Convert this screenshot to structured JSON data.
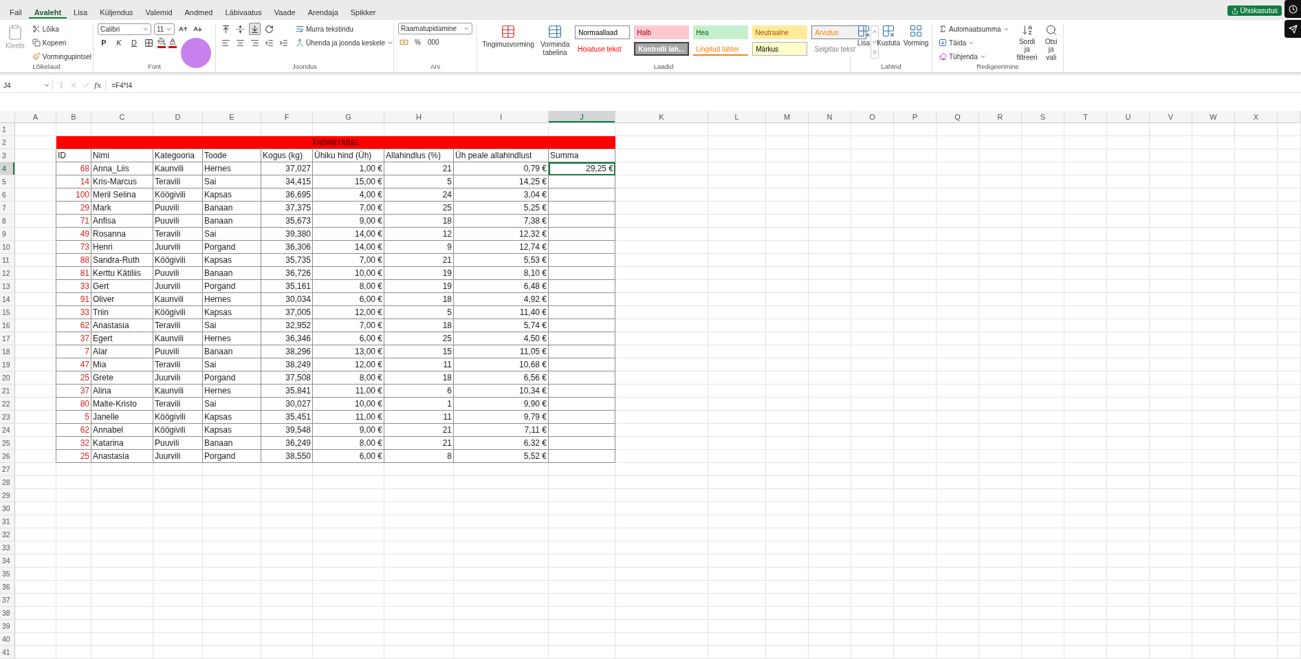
{
  "menu_tabs": [
    {
      "label": "Fail",
      "selected": false
    },
    {
      "label": "Avaleht",
      "selected": true
    },
    {
      "label": "Lisa",
      "selected": false
    },
    {
      "label": "Küljendus",
      "selected": false
    },
    {
      "label": "Valemid",
      "selected": false
    },
    {
      "label": "Andmed",
      "selected": false
    },
    {
      "label": "Läbivaatus",
      "selected": false
    },
    {
      "label": "Vaade",
      "selected": false
    },
    {
      "label": "Arendaja",
      "selected": false
    },
    {
      "label": "Spikker",
      "selected": false
    }
  ],
  "share_button": "Ühiskasutus",
  "ribbon": {
    "clipboard": {
      "paste": {
        "label": "Kleebi",
        "disabled": true
      },
      "items": [
        "Lõika",
        "Kopeeri",
        "Vormingupintsel"
      ],
      "label": "Lõikelaud"
    },
    "font": {
      "font_name": "Calibri",
      "font_size": "11",
      "style_buttons": [
        "P",
        "K",
        "D"
      ],
      "label": "Font"
    },
    "alignment": {
      "wrap_text": "Murra tekstiridu",
      "merge": "Ühenda ja joonda keskele",
      "label": "Joondus"
    },
    "number": {
      "format": "Raamatupidamine",
      "buttons": [
        "%",
        "000"
      ],
      "label": "Arv"
    },
    "styles": {
      "conditional": "Tingimusvorming",
      "format_table": "Vorminda tabelina",
      "gallery": [
        {
          "label": "Normaallaad",
          "kind": "normal"
        },
        {
          "label": "Halb",
          "kind": "bad"
        },
        {
          "label": "Hea",
          "kind": "good"
        },
        {
          "label": "Neutraalne",
          "kind": "neutral"
        },
        {
          "label": "Arvutus",
          "kind": "calculation"
        },
        {
          "label": "Hoiatuse tekst",
          "kind": "warning"
        },
        {
          "label": "Kontrolli lah...",
          "kind": "check"
        },
        {
          "label": "Lingitud lahter",
          "kind": "linked"
        },
        {
          "label": "Märkus",
          "kind": "note"
        },
        {
          "label": "Selgitav tekst",
          "kind": "explanatory"
        }
      ],
      "label": "Laadid"
    },
    "cells": {
      "buttons": [
        "Lisa",
        "Kustuta",
        "Vorming"
      ],
      "label": "Lahtrid"
    },
    "editing": {
      "autosum": "Automaatsumma",
      "fill": "Täida",
      "clear": "Tühjenda",
      "sort": "Sordi ja filtreeri",
      "find": "Otsi ja vali",
      "label": "Redigeerimine"
    }
  },
  "cursor_highlight": true,
  "name_box": "J4",
  "function_label": "fx",
  "formula": "=F4*I4",
  "sheet": {
    "column_headers": [
      {
        "label": "A",
        "selected": false
      },
      {
        "label": "B",
        "selected": false
      },
      {
        "label": "C",
        "selected": false
      },
      {
        "label": "D",
        "selected": false
      },
      {
        "label": "E",
        "selected": false
      },
      {
        "label": "F",
        "selected": false
      },
      {
        "label": "G",
        "selected": false
      },
      {
        "label": "H",
        "selected": false
      },
      {
        "label": "I",
        "selected": false
      },
      {
        "label": "J",
        "selected": true
      },
      {
        "label": "K",
        "selected": false
      },
      {
        "label": "L",
        "selected": false
      },
      {
        "label": "M",
        "selected": false
      },
      {
        "label": "N",
        "selected": false
      },
      {
        "label": "O",
        "selected": false
      },
      {
        "label": "P",
        "selected": false
      },
      {
        "label": "Q",
        "selected": false
      },
      {
        "label": "R",
        "selected": false
      },
      {
        "label": "S",
        "selected": false
      },
      {
        "label": "T",
        "selected": false
      },
      {
        "label": "U",
        "selected": false
      },
      {
        "label": "V",
        "selected": false
      },
      {
        "label": "W",
        "selected": false
      },
      {
        "label": "X",
        "selected": false
      }
    ],
    "row_numbers": [
      {
        "label": "1",
        "selected": false
      },
      {
        "label": "2",
        "selected": false
      },
      {
        "label": "3",
        "selected": false
      },
      {
        "label": "4",
        "selected": true
      },
      {
        "label": "5",
        "selected": false
      },
      {
        "label": "6",
        "selected": false
      },
      {
        "label": "7",
        "selected": false
      },
      {
        "label": "8",
        "selected": false
      },
      {
        "label": "9",
        "selected": false
      },
      {
        "label": "10",
        "selected": false
      },
      {
        "label": "11",
        "selected": false
      },
      {
        "label": "12",
        "selected": false
      },
      {
        "label": "13",
        "selected": false
      },
      {
        "label": "14",
        "selected": false
      },
      {
        "label": "15",
        "selected": false
      },
      {
        "label": "16",
        "selected": false
      },
      {
        "label": "17",
        "selected": false
      },
      {
        "label": "18",
        "selected": false
      },
      {
        "label": "19",
        "selected": false
      },
      {
        "label": "20",
        "selected": false
      },
      {
        "label": "21",
        "selected": false
      },
      {
        "label": "22",
        "selected": false
      },
      {
        "label": "23",
        "selected": false
      },
      {
        "label": "24",
        "selected": false
      },
      {
        "label": "25",
        "selected": false
      },
      {
        "label": "26",
        "selected": false
      },
      {
        "label": "27",
        "selected": false
      },
      {
        "label": "28",
        "selected": false
      },
      {
        "label": "29",
        "selected": false
      },
      {
        "label": "30",
        "selected": false
      },
      {
        "label": "31",
        "selected": false
      },
      {
        "label": "32",
        "selected": false
      },
      {
        "label": "33",
        "selected": false
      },
      {
        "label": "34",
        "selected": false
      },
      {
        "label": "35",
        "selected": false
      },
      {
        "label": "36",
        "selected": false
      },
      {
        "label": "37",
        "selected": false
      },
      {
        "label": "38",
        "selected": false
      },
      {
        "label": "39",
        "selected": false
      },
      {
        "label": "40",
        "selected": false
      },
      {
        "label": "41",
        "selected": false
      }
    ],
    "title": "ANDMETABEL",
    "table_headers": [
      "ID",
      "Nimi",
      "Kategooria",
      "Toode",
      "Kogus (kg)",
      "Ühiku hind (Üh)",
      "Allahindlus (%)",
      "Üh peale allahindlust",
      "Summa"
    ],
    "rows": [
      {
        "cells": [
          "68",
          "Anna_Liis",
          "Kaunvili",
          "Hernes",
          "37,027",
          "1,00 €",
          "21",
          "0,79 €"
        ],
        "summa": "29,25 €",
        "summa_selected": true
      },
      {
        "cells": [
          "14",
          "Kris-Marcus",
          "Teravili",
          "Sai",
          "34,415",
          "15,00 €",
          "5",
          "14,25 €"
        ],
        "summa_selected": false
      },
      {
        "cells": [
          "100",
          "Meril Selina",
          "Köögivili",
          "Kapsas",
          "36,695",
          "4,00 €",
          "24",
          "3,04 €"
        ],
        "summa_selected": false
      },
      {
        "cells": [
          "29",
          "Mark",
          "Puuvili",
          "Banaan",
          "37,375",
          "7,00 €",
          "25",
          "5,25 €"
        ],
        "summa_selected": false
      },
      {
        "cells": [
          "71",
          "Anfisa",
          "Puuvili",
          "Banaan",
          "35,673",
          "9,00 €",
          "18",
          "7,38 €"
        ],
        "summa_selected": false
      },
      {
        "cells": [
          "49",
          "Rosanna",
          "Teravili",
          "Sai",
          "39,380",
          "14,00 €",
          "12",
          "12,32 €"
        ],
        "summa_selected": false
      },
      {
        "cells": [
          "73",
          "Henri",
          "Juurvili",
          "Porgand",
          "36,306",
          "14,00 €",
          "9",
          "12,74 €"
        ],
        "summa_selected": false
      },
      {
        "cells": [
          "88",
          "Sandra-Ruth",
          "Köögivili",
          "Kapsas",
          "35,735",
          "7,00 €",
          "21",
          "5,53 €"
        ],
        "summa_selected": false
      },
      {
        "cells": [
          "81",
          "Kerttu Kätiliis",
          "Puuvili",
          "Banaan",
          "36,726",
          "10,00 €",
          "19",
          "8,10 €"
        ],
        "summa_selected": false
      },
      {
        "cells": [
          "33",
          "Gert",
          "Juurvili",
          "Porgand",
          "35,161",
          "8,00 €",
          "19",
          "6,48 €"
        ],
        "summa_selected": false
      },
      {
        "cells": [
          "91",
          "Oliver",
          "Kaunvili",
          "Hernes",
          "30,034",
          "6,00 €",
          "18",
          "4,92 €"
        ],
        "summa_selected": false
      },
      {
        "cells": [
          "33",
          "Triin",
          "Köögivili",
          "Kapsas",
          "37,005",
          "12,00 €",
          "5",
          "11,40 €"
        ],
        "summa_selected": false
      },
      {
        "cells": [
          "62",
          "Anastasia",
          "Teravili",
          "Sai",
          "32,952",
          "7,00 €",
          "18",
          "5,74 €"
        ],
        "summa_selected": false
      },
      {
        "cells": [
          "37",
          "Egert",
          "Kaunvili",
          "Hernes",
          "36,346",
          "6,00 €",
          "25",
          "4,50 €"
        ],
        "summa_selected": false
      },
      {
        "cells": [
          "7",
          "Alar",
          "Puuvili",
          "Banaan",
          "38,296",
          "13,00 €",
          "15",
          "11,05 €"
        ],
        "summa_selected": false
      },
      {
        "cells": [
          "47",
          "Mia",
          "Teravili",
          "Sai",
          "38,249",
          "12,00 €",
          "11",
          "10,68 €"
        ],
        "summa_selected": false
      },
      {
        "cells": [
          "25",
          "Grete",
          "Juurvili",
          "Porgand",
          "37,508",
          "8,00 €",
          "18",
          "6,56 €"
        ],
        "summa_selected": false
      },
      {
        "cells": [
          "37",
          "Alina",
          "Kaunvili",
          "Hernes",
          "35,841",
          "11,00 €",
          "6",
          "10,34 €"
        ],
        "summa_selected": false
      },
      {
        "cells": [
          "80",
          "Malte-Kristo",
          "Teravili",
          "Sai",
          "30,027",
          "10,00 €",
          "1",
          "9,90 €"
        ],
        "summa_selected": false
      },
      {
        "cells": [
          "5",
          "Janelle",
          "Köögivili",
          "Kapsas",
          "35,451",
          "11,00 €",
          "11",
          "9,79 €"
        ],
        "summa_selected": false
      },
      {
        "cells": [
          "62",
          "Annabel",
          "Köögivili",
          "Kapsas",
          "39,548",
          "9,00 €",
          "21",
          "7,11 €"
        ],
        "summa_selected": false
      },
      {
        "cells": [
          "32",
          "Katarina",
          "Puuvili",
          "Banaan",
          "36,249",
          "8,00 €",
          "21",
          "6,32 €"
        ],
        "summa_selected": false
      },
      {
        "cells": [
          "25",
          "Anastasia",
          "Juurvili",
          "Porgand",
          "38,550",
          "6,00 €",
          "8",
          "5,52 €"
        ],
        "summa_selected": false
      }
    ]
  }
}
